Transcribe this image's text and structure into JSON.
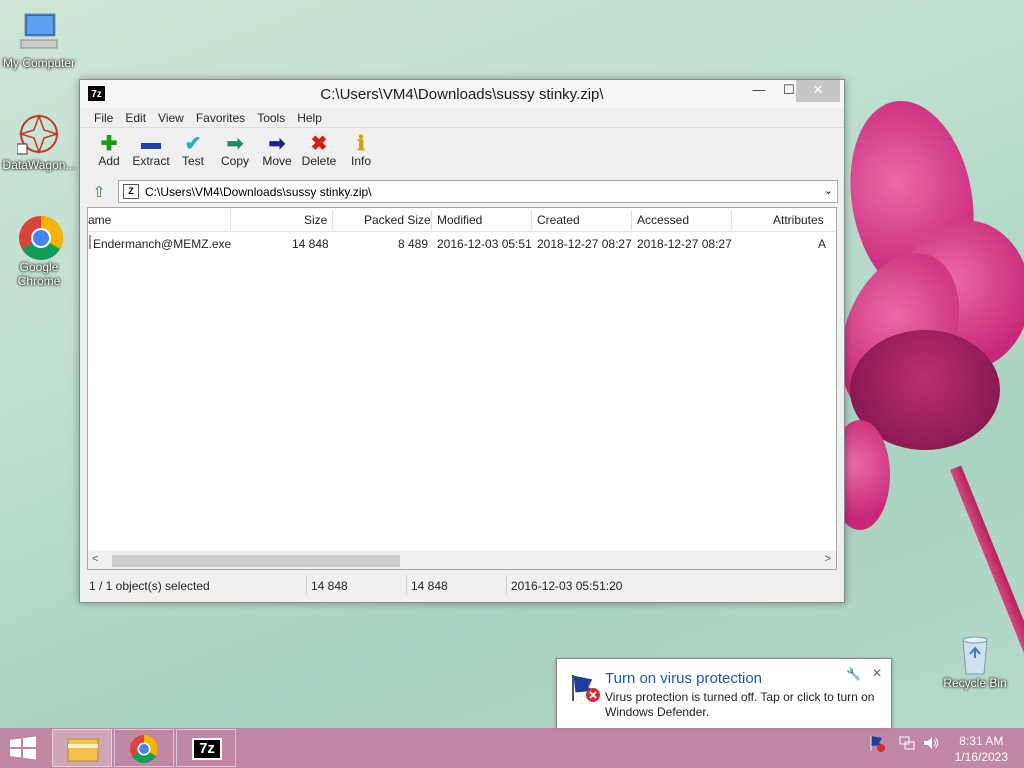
{
  "desktop": {
    "icons": [
      {
        "label": "My Computer"
      },
      {
        "label": "DataWagon..."
      },
      {
        "label": "Google Chrome"
      },
      {
        "label": "Recycle Bin"
      }
    ]
  },
  "window": {
    "title": "C:\\Users\\VM4\\Downloads\\sussy stinky.zip\\",
    "app_icon": "7z",
    "controls": {
      "minimize": "—",
      "maximize": "☐",
      "close": "✕"
    },
    "menu": [
      "File",
      "Edit",
      "View",
      "Favorites",
      "Tools",
      "Help"
    ],
    "toolbar": [
      {
        "label": "Add",
        "icon": "plus-icon",
        "glyph": "✚",
        "color": "#1a9b1a"
      },
      {
        "label": "Extract",
        "icon": "minus-icon",
        "glyph": "▬",
        "color": "#1f3fb0"
      },
      {
        "label": "Test",
        "icon": "check-icon",
        "glyph": "✔",
        "color": "#1fb5b5"
      },
      {
        "label": "Copy",
        "icon": "copy-arrow-icon",
        "glyph": "➡",
        "color": "#1e8a6a"
      },
      {
        "label": "Move",
        "icon": "move-arrow-icon",
        "glyph": "➡",
        "color": "#1a237e"
      },
      {
        "label": "Delete",
        "icon": "delete-x-icon",
        "glyph": "✖",
        "color": "#d81b1b"
      },
      {
        "label": "Info",
        "icon": "info-icon",
        "glyph": "ℹ",
        "color": "#c9a400"
      }
    ],
    "address": {
      "path": "C:\\Users\\VM4\\Downloads\\sussy stinky.zip\\",
      "dropdown": "⌄"
    },
    "columns": [
      "ame",
      "Size",
      "Packed Size",
      "Modified",
      "Created",
      "Accessed",
      "Attributes"
    ],
    "rows": [
      {
        "name": "Endermanch@MEMZ.exe",
        "size": "14 848",
        "packed": "8 489",
        "modified": "2016-12-03 05:51",
        "created": "2018-12-27 08:27",
        "accessed": "2018-12-27 08:27",
        "attributes": "A"
      }
    ],
    "status": {
      "selected": "1 / 1 object(s) selected",
      "size": "14 848",
      "packed": "14 848",
      "modified": "2016-12-03 05:51:20"
    }
  },
  "notification": {
    "title": "Turn on virus protection",
    "body": "Virus protection is turned off. Tap or click to turn on Windows Defender."
  },
  "taskbar": {
    "apps": [
      "file-explorer",
      "google-chrome",
      "7-zip"
    ],
    "app_7z_label": "7z",
    "time": "8:31 AM",
    "date": "1/16/2023"
  }
}
